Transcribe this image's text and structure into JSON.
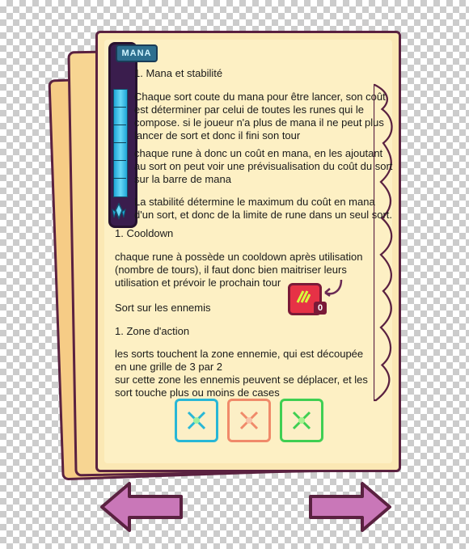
{
  "mana": {
    "label": "MANA",
    "color": "#2fb8e4"
  },
  "sections": {
    "s1_title": "1. Mana et stabilité",
    "s1_p1": "Chaque sort coute du mana pour être lancer, son coût\nest déterminer par celui de toutes les runes qui le\ncompose. si le joueur n'a plus de mana il ne peut plus\nlancer de sort et donc il fini son tour",
    "s1_p2": "chaque rune à donc un coût en mana, en les ajoutant\nau sort on peut voir une prévisualisation du coût du sort\nsur la barre de mana",
    "s1_p3": "La stabilité détermine le maximum du coût en mana\nd'un sort, et donc de la limite de rune dans un seul sort.",
    "s2_title": "1. Cooldown",
    "s2_p1": "chaque rune à possède un cooldown après utilisation\n(nombre de tours), il faut donc bien maitriser leurs\nutilisation et prévoir le prochain tour",
    "s3_title": "Sort sur les ennemis",
    "s4_title": "1. Zone d'action",
    "s4_p1": "les sorts touchent la zone ennemie, qui est découpée\nen une grille de 3 par 2\nsur cette zone les ennemis peuvent se déplacer, et les\nsort touche plus ou moins de cases"
  },
  "cooldown_badge": "0",
  "zones": [
    {
      "icon": "crossed-arrows-icon",
      "color": "#28b7d6"
    },
    {
      "icon": "crossed-arrows-icon",
      "color": "#f08a6a"
    },
    {
      "icon": "crossed-arrows-icon",
      "color": "#3fcf52"
    }
  ],
  "nav": {
    "prev_icon": "arrow-left-icon",
    "next_icon": "arrow-right-icon",
    "color": "#c977b8"
  }
}
